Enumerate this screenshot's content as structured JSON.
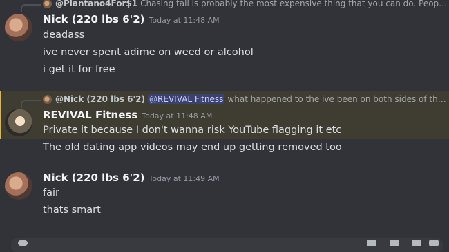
{
  "messages": [
    {
      "reply": {
        "name": "@Plantano4For$1",
        "mention": "",
        "text": "Chasing tail is probably the most expensive thing that you can do. People l..."
      },
      "author": "Nick (220 lbs 6'2)",
      "time": "Today at 11:48 AM",
      "lines": [
        "deadass",
        "ive never spent  adime on weed or alcohol",
        "i get it for free"
      ]
    },
    {
      "reply": {
        "name": "@Nick (220 lbs 6'2)",
        "mention": "@REVIVAL Fitness",
        "text": "what happened to the ive been on both sides of the ..."
      },
      "author": "REVIVAL Fitness",
      "time": "Today at 11:48 AM",
      "lines": [
        "Private it because I don't wanna risk YouTube flagging it etc",
        "The old dating app videos may end up getting removed too"
      ]
    },
    {
      "author": "Nick (220 lbs 6'2)",
      "time": "Today at 11:49 AM",
      "lines": [
        "fair",
        "thats smart"
      ]
    }
  ],
  "colors": {
    "background": "#313338",
    "mention_highlight": "#3f3c31",
    "accent": "#f0b232"
  }
}
